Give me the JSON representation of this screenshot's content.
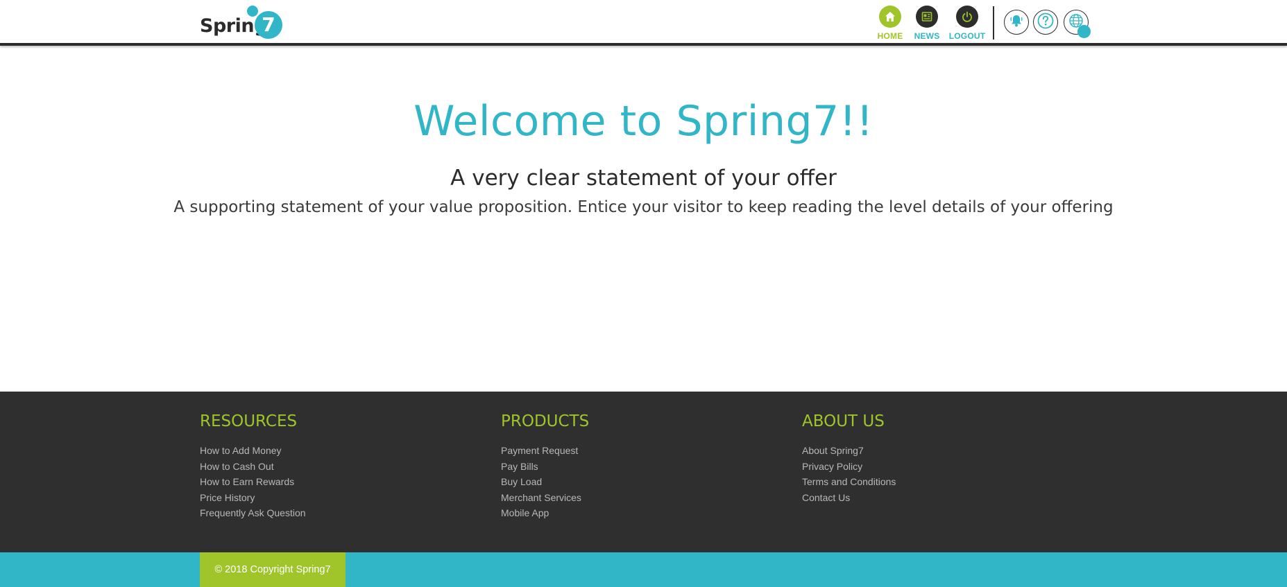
{
  "brand": {
    "logo_text": "Spring",
    "logo_number": "7",
    "primary_color": "#31b6c8",
    "accent_color": "#9fc52a",
    "dark_color": "#2d2d2d"
  },
  "header": {
    "nav": [
      {
        "label": "HOME",
        "icon": "home-icon"
      },
      {
        "label": "NEWS",
        "icon": "news-icon"
      },
      {
        "label": "LOGOUT",
        "icon": "power-icon"
      }
    ],
    "utilities": [
      {
        "icon": "bell-icon"
      },
      {
        "icon": "help-icon"
      },
      {
        "icon": "globe-icon"
      }
    ]
  },
  "hero": {
    "title": "Welcome to Spring7!!",
    "subtitle": "A very clear statement of your offer",
    "supporting": "A supporting statement of your value proposition. Entice your visitor to keep reading the level details of your offering"
  },
  "footer": {
    "columns": [
      {
        "heading": "RESOURCES",
        "links": [
          "How to Add Money",
          "How to Cash Out",
          "How to Earn Rewards",
          "Price History",
          "Frequently Ask Question"
        ]
      },
      {
        "heading": "PRODUCTS",
        "links": [
          "Payment Request",
          "Pay Bills",
          "Buy Load",
          "Merchant Services",
          "Mobile App"
        ]
      },
      {
        "heading": "ABOUT US",
        "links": [
          "About Spring7",
          "Privacy Policy",
          "Terms and Conditions",
          "Contact Us"
        ]
      }
    ],
    "copyright": "© 2018 Copyright Spring7"
  }
}
